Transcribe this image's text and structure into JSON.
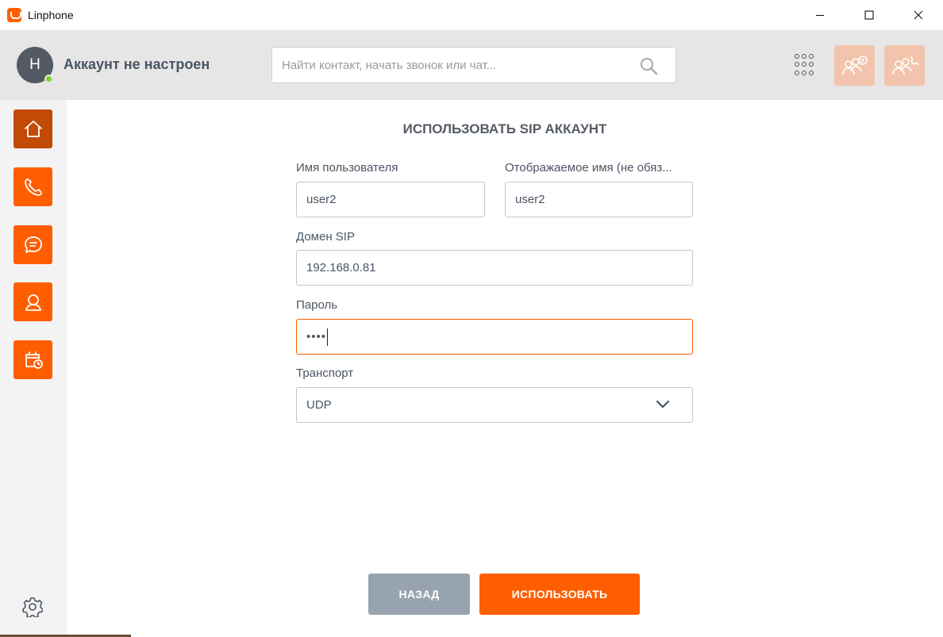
{
  "window": {
    "title": "Linphone"
  },
  "header": {
    "avatar_initial": "H",
    "account_name": "Аккаунт не настроен",
    "search_placeholder": "Найти контакт, начать звонок или чат..."
  },
  "content": {
    "title": "ИСПОЛЬЗОВАТЬ SIP АККАУНТ",
    "username_label": "Имя пользователя",
    "username_value": "user2",
    "display_name_label": "Отображаемое имя (не обяз...",
    "display_name_value": "user2",
    "domain_label": "Домен SIP",
    "domain_value": "192.168.0.81",
    "password_label": "Пароль",
    "password_value": "••••",
    "transport_label": "Транспорт",
    "transport_value": "UDP",
    "back_label": "НАЗАД",
    "use_label": "ИСПОЛЬЗОВАТЬ"
  },
  "colors": {
    "accent": "#ff5e00",
    "accent_active": "#c24a05",
    "back_button": "#97a3ae",
    "header_bg": "#e6e6e6",
    "sidebar_bg": "#f3f3f3"
  },
  "icons": {
    "sidebar": [
      "home-icon",
      "phone-icon",
      "chat-icon",
      "contact-icon",
      "calendar-icon"
    ],
    "header": [
      "search-icon",
      "dialpad-icon",
      "conference-chat-icon",
      "conference-call-icon"
    ],
    "footer": [
      "settings-icon"
    ]
  }
}
